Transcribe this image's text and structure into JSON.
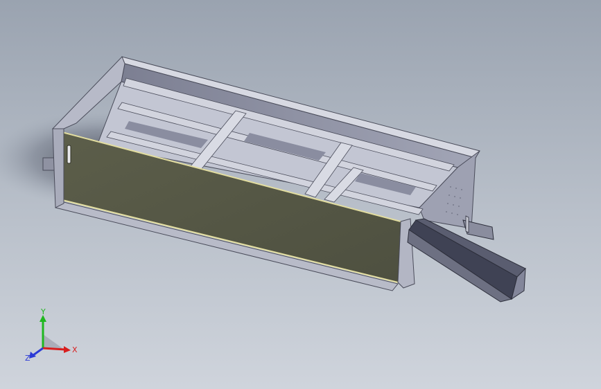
{
  "viewport": {
    "background_top": "#9aa3b0",
    "background_bottom": "#cfd4dc"
  },
  "triad": {
    "x_label": "X",
    "y_label": "Y",
    "z_label": "Z",
    "x_color": "#d81e1e",
    "y_color": "#1fb71f",
    "z_color": "#2b3ad6"
  }
}
